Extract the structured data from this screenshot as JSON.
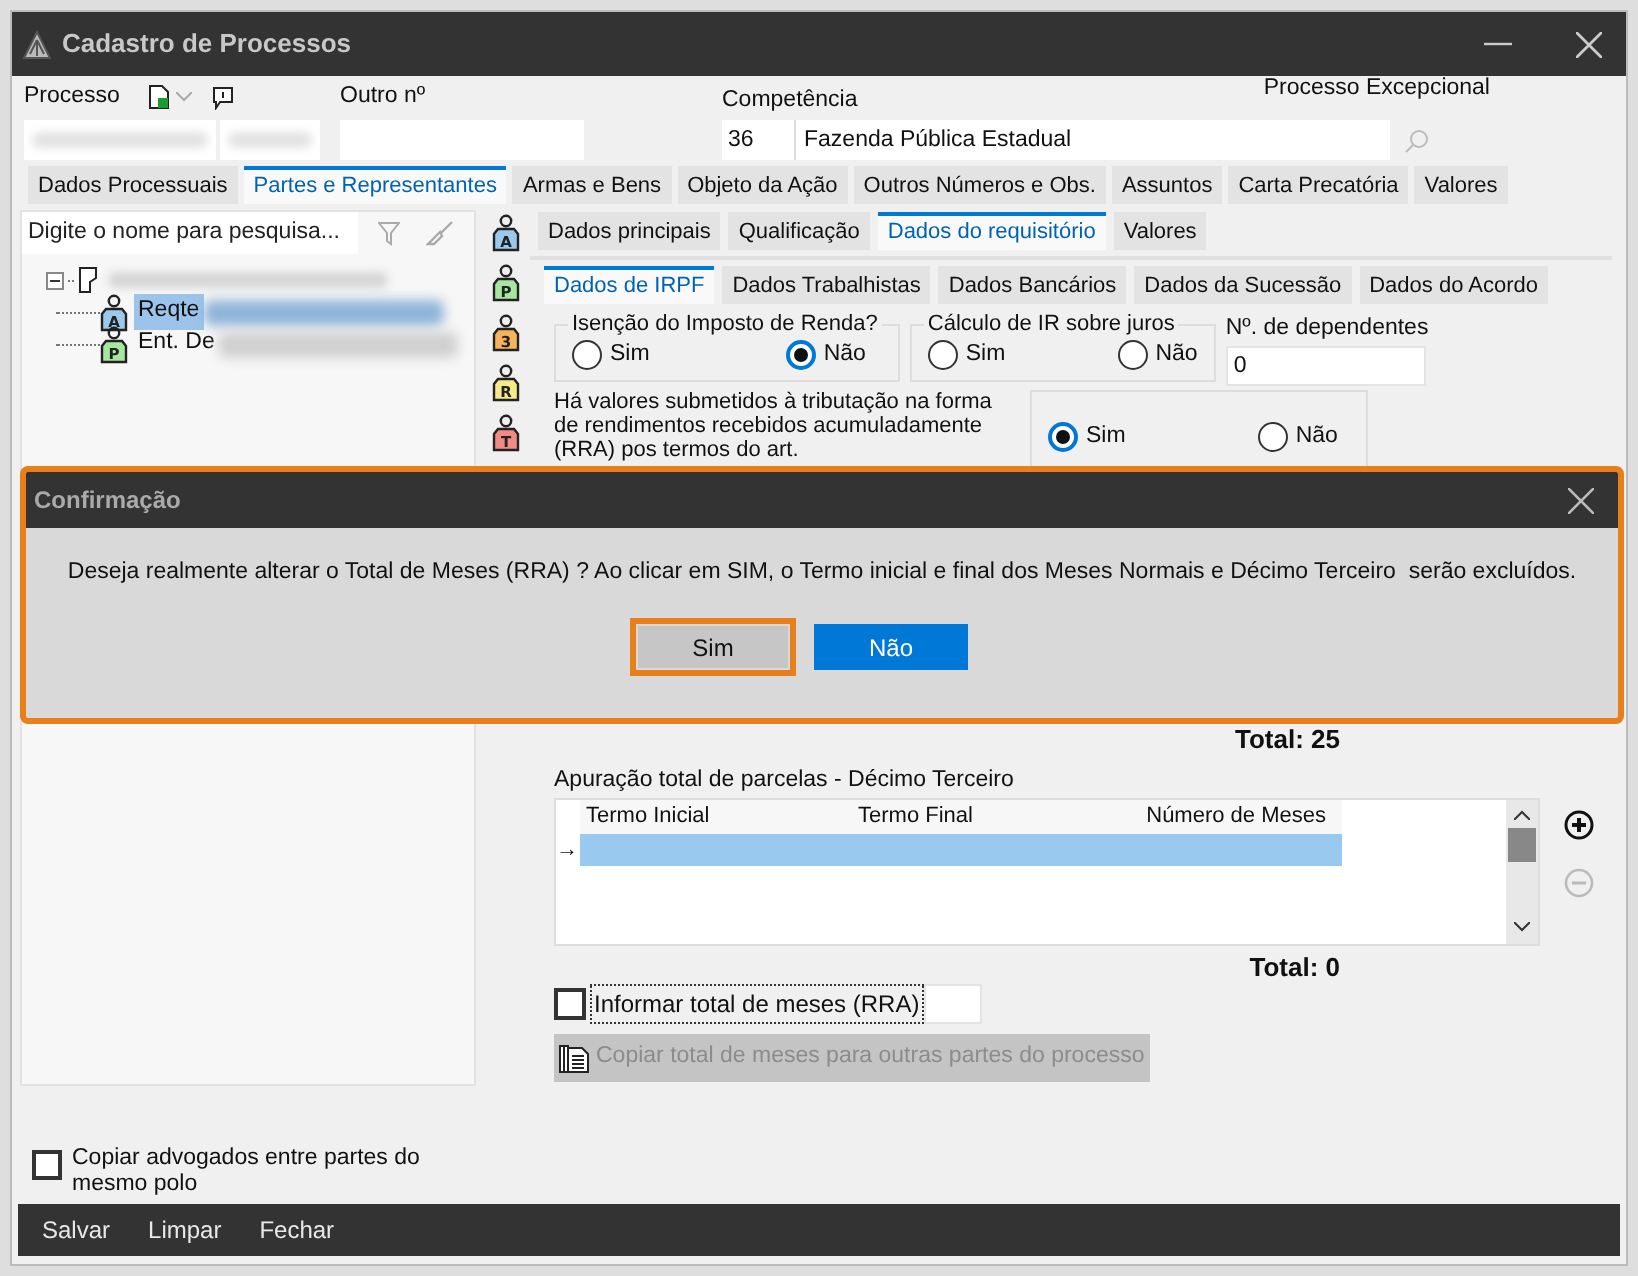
{
  "window": {
    "title": "Cadastro de Processos"
  },
  "header": {
    "processo_label": "Processo",
    "outro_label": "Outro nº",
    "competencia_label": "Competência",
    "competencia_code": "36",
    "competencia_name": "Fazenda Pública Estadual",
    "excepcional_label": "Processo Excepcional"
  },
  "tabs": [
    {
      "label": "Dados Processuais",
      "selected": false
    },
    {
      "label": "Partes e Representantes",
      "selected": true
    },
    {
      "label": "Armas e Bens",
      "selected": false
    },
    {
      "label": "Objeto da Ação",
      "selected": false
    },
    {
      "label": "Outros Números e Obs.",
      "selected": false
    },
    {
      "label": "Assuntos",
      "selected": false
    },
    {
      "label": "Carta Precatória",
      "selected": false
    },
    {
      "label": "Valores",
      "selected": false
    }
  ],
  "search": {
    "placeholder": "Digite o nome para pesquisa..."
  },
  "tree": {
    "expanded": true,
    "children": [
      {
        "label": "Reqte",
        "letter": "A",
        "color": "#9cc8ec",
        "selected": true
      },
      {
        "label": "Ent. De",
        "letter": "P",
        "color": "#a6e6a0",
        "selected": false
      }
    ]
  },
  "party_types": [
    {
      "letter": "A",
      "color": "#9cc8ec"
    },
    {
      "letter": "P",
      "color": "#a6e6a0"
    },
    {
      "letter": "3",
      "color": "#f5b35c"
    },
    {
      "letter": "R",
      "color": "#f5e98a"
    },
    {
      "letter": "T",
      "color": "#f08a84"
    }
  ],
  "subtabs": [
    {
      "label": "Dados principais",
      "selected": false
    },
    {
      "label": "Qualificação",
      "selected": false
    },
    {
      "label": "Dados do requisitório",
      "selected": true
    },
    {
      "label": "Valores",
      "selected": false
    }
  ],
  "subtabs2": [
    {
      "label": "Dados de IRPF",
      "selected": true
    },
    {
      "label": "Dados Trabalhistas",
      "selected": false
    },
    {
      "label": "Dados Bancários",
      "selected": false
    },
    {
      "label": "Dados da Sucessão",
      "selected": false
    },
    {
      "label": "Dados do Acordo",
      "selected": false
    }
  ],
  "irpf": {
    "isencao": {
      "label": "Isenção do Imposto de Renda?",
      "options": [
        {
          "label": "Sim",
          "selected": false
        },
        {
          "label": "Não",
          "selected": true
        }
      ]
    },
    "juros": {
      "label": "Cálculo de IR sobre juros",
      "options": [
        {
          "label": "Sim",
          "selected": false
        },
        {
          "label": "Não",
          "selected": false
        }
      ]
    },
    "dependentes": {
      "label": "Nº. de dependentes",
      "value": "0"
    },
    "rra_question": "Há valores submetidos à tributação na forma de rendimentos recebidos acumuladamente (RRA) pos termos do art.",
    "rra_options": [
      {
        "label": "Sim",
        "selected": true
      },
      {
        "label": "Não",
        "selected": false
      }
    ]
  },
  "total_normais": "Total: 25",
  "decimo": {
    "title": "Apuração total de parcelas - Décimo Terceiro",
    "columns": [
      "Termo Inicial",
      "Termo Final",
      "Número de Meses"
    ],
    "rows": [
      {
        "marker": "→",
        "selected": true
      }
    ],
    "total": "Total: 0"
  },
  "informar": {
    "label": "Informar total de meses (RRA)",
    "checked": false
  },
  "copy_button": {
    "label": "Copiar total de meses para outras partes do processo",
    "disabled": true
  },
  "copiar_advogados": {
    "label": "Copiar advogados entre partes do mesmo polo",
    "checked": false
  },
  "footer": [
    "Salvar",
    "Limpar",
    "Fechar"
  ],
  "dialog": {
    "title": "Confirmação",
    "message": "Deseja realmente alterar o Total de Meses (RRA) ? Ao clicar em SIM, o Termo inicial e final dos Meses Normais e Décimo Terceiro  serão excluídos.",
    "buttons": [
      {
        "label": "Sim",
        "kind": "secondary",
        "focused": true
      },
      {
        "label": "Não",
        "kind": "primary",
        "focused": false
      }
    ]
  }
}
